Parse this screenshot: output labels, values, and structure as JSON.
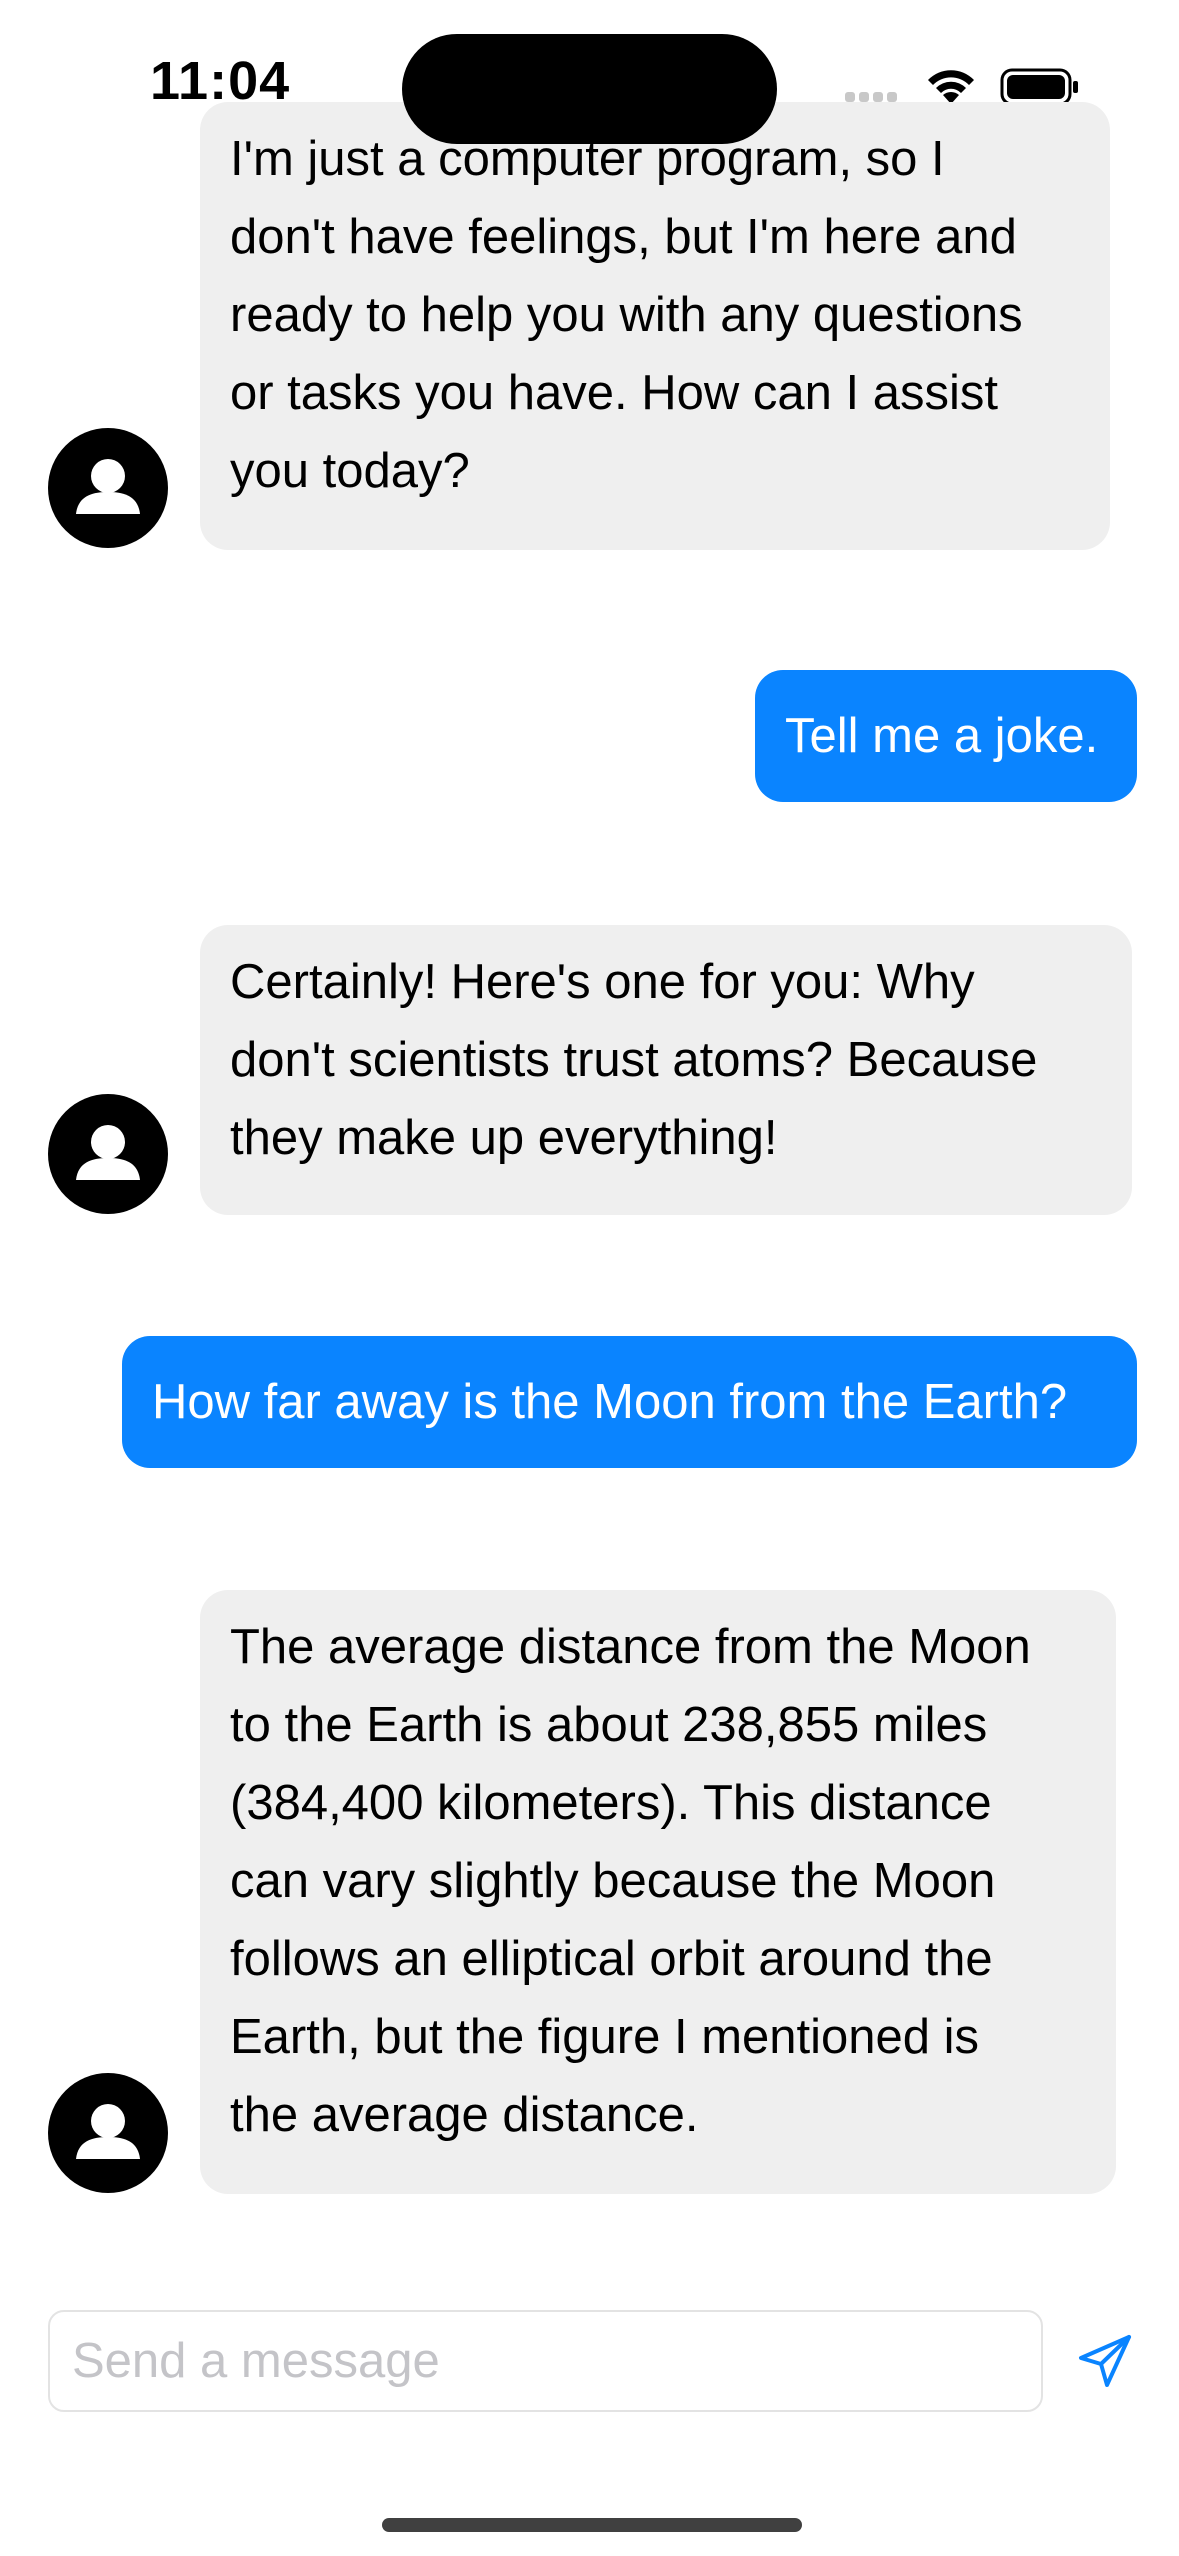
{
  "status_bar": {
    "time": "11:04"
  },
  "messages": [
    {
      "role": "assistant",
      "text": "I'm just a computer program, so I\ndon't have feelings, but I'm here and\nready to help you with any questions\nor tasks you have. How can I assist\nyou today?"
    },
    {
      "role": "user",
      "text": "Tell me a joke."
    },
    {
      "role": "assistant",
      "text": "Certainly! Here's one for you: Why\ndon't scientists trust atoms? Because\nthey make up everything!"
    },
    {
      "role": "user",
      "text": "How far away is the Moon from the Earth?"
    },
    {
      "role": "assistant",
      "text": "The average distance from the Moon\nto the Earth is about 238,855 miles\n(384,400 kilometers). This distance\ncan vary slightly because the Moon\nfollows an elliptical orbit around the\nEarth, but the figure I mentioned is\nthe average distance."
    }
  ],
  "composer": {
    "placeholder": "Send a message",
    "value": "",
    "send_icon": "paperplane-icon"
  },
  "colors": {
    "user_bubble": "#0a84ff",
    "assistant_bubble": "#efefef",
    "accent": "#0a84ff"
  }
}
